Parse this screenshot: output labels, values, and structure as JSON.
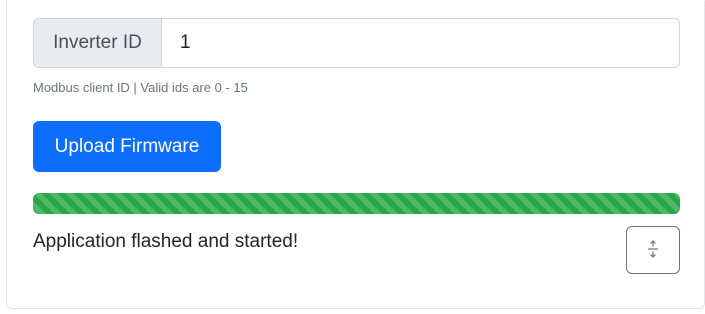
{
  "form": {
    "inverter_id_label": "Inverter ID",
    "inverter_id_value": "1",
    "help_text": "Modbus client ID | Valid ids are 0 - 15"
  },
  "actions": {
    "upload_label": "Upload Firmware"
  },
  "progress": {
    "percent": 100,
    "color": "#28a745",
    "striped": true
  },
  "status": {
    "message": "Application flashed and started!"
  },
  "icons": {
    "toggle": "expand-vertical-icon"
  },
  "colors": {
    "primary": "#0d6efd",
    "success": "#28a745",
    "muted": "#6c757d"
  }
}
